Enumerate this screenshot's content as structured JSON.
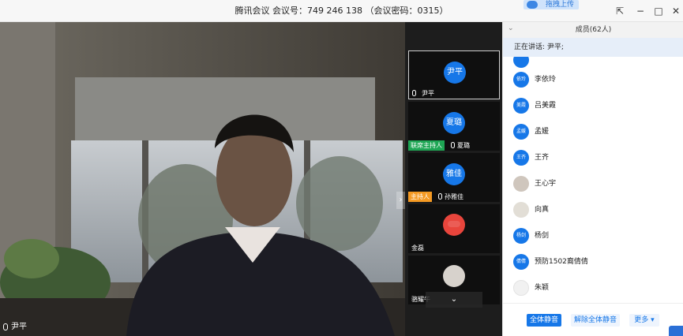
{
  "titlebar": {
    "title": "腾讯会议 会议号：749 246 138 （会议密码：0315）",
    "upload_label": "拖拽上传"
  },
  "main_video": {
    "speaker_name": "尹平"
  },
  "thumbnails": [
    {
      "avatar_text": "尹平",
      "name": "尹平",
      "role": ""
    },
    {
      "avatar_text": "夏璐",
      "name": "夏璐",
      "role": "联席主持人"
    },
    {
      "avatar_text": "雅佳",
      "name": "孙雅佳",
      "role": "主持人"
    },
    {
      "avatar_text": "",
      "name": "金磊",
      "role": ""
    },
    {
      "avatar_text": "",
      "name": "骆耀午",
      "role": ""
    }
  ],
  "panel": {
    "member_count": "成员(62人)",
    "speaking_now": "正在讲话: 尹平;",
    "members": [
      {
        "avatar_text": "依玲",
        "name": "李依玲"
      },
      {
        "avatar_text": "美霞",
        "name": "吕美霞"
      },
      {
        "avatar_text": "孟媛",
        "name": "孟媛"
      },
      {
        "avatar_text": "王齐",
        "name": "王齐"
      },
      {
        "avatar_text": "",
        "name": "王心宇"
      },
      {
        "avatar_text": "",
        "name": "向真"
      },
      {
        "avatar_text": "杨剑",
        "name": "杨剑"
      },
      {
        "avatar_text": "倩倩",
        "name": "预防1502裔倩倩"
      },
      {
        "avatar_text": "",
        "name": "朱颖"
      }
    ],
    "mute_all": "全体静音",
    "unmute_all": "解除全体静音",
    "more": "更多 ▾"
  },
  "colors": {
    "accent": "#1677e8",
    "co_host_badge": "#1ea654",
    "host_badge": "#f59a23"
  }
}
